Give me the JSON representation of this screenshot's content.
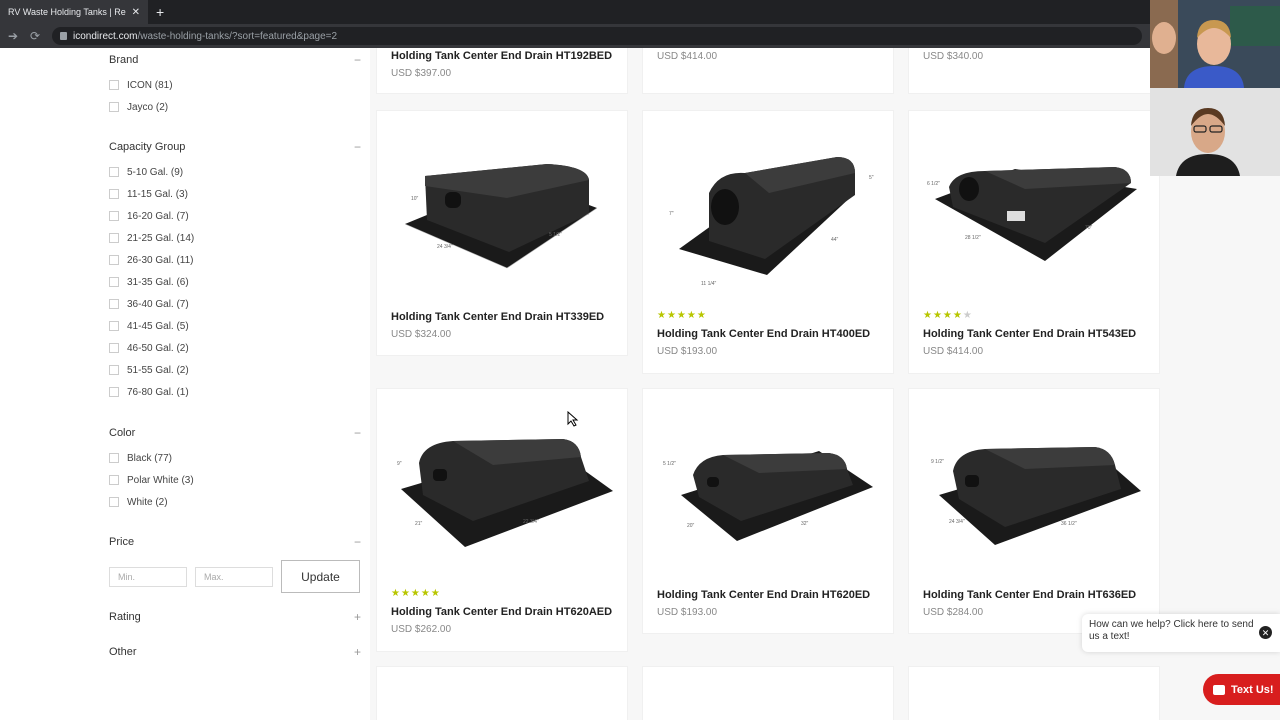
{
  "browser": {
    "tab_title": "RV Waste Holding Tanks | Replac",
    "tab_close": "✕",
    "new_tab": "+",
    "url_host": "icondirect.com",
    "url_path": "/waste-holding-tanks/?sort=featured&page=2"
  },
  "filters": {
    "brand": {
      "title": "Brand",
      "toggle": "−",
      "options": [
        "ICON (81)",
        "Jayco (2)"
      ]
    },
    "capacity": {
      "title": "Capacity Group",
      "toggle": "−",
      "options": [
        "5-10 Gal. (9)",
        "11-15 Gal. (3)",
        "16-20 Gal. (7)",
        "21-25 Gal. (14)",
        "26-30 Gal. (11)",
        "31-35 Gal. (6)",
        "36-40 Gal. (7)",
        "41-45 Gal. (5)",
        "46-50 Gal. (2)",
        "51-55 Gal. (2)",
        "76-80 Gal. (1)"
      ]
    },
    "color": {
      "title": "Color",
      "toggle": "−",
      "options": [
        "Black (77)",
        "Polar White (3)",
        "White (2)"
      ]
    },
    "price": {
      "title": "Price",
      "toggle": "−",
      "min_placeholder": "Min.",
      "max_placeholder": "Max.",
      "update_label": "Update"
    },
    "rating": {
      "title": "Rating",
      "toggle": "+"
    },
    "other": {
      "title": "Other",
      "toggle": "+"
    }
  },
  "products": {
    "top": [
      {
        "name": "Holding Tank Center End Drain HT192BED",
        "price": "USD $397.00"
      },
      {
        "name": "",
        "price": "USD $414.00"
      },
      {
        "name": "",
        "price": "USD $340.00"
      }
    ],
    "row1": [
      {
        "name": "Holding Tank Center End Drain HT339ED",
        "price": "USD $324.00",
        "rating": 0
      },
      {
        "name": "Holding Tank Center End Drain HT400ED",
        "price": "USD $193.00",
        "rating": 5
      },
      {
        "name": "Holding Tank Center End Drain HT543ED",
        "price": "USD $414.00",
        "rating": 4
      }
    ],
    "row2": [
      {
        "name": "Holding Tank Center End Drain HT620AED",
        "price": "USD $262.00",
        "rating": 5
      },
      {
        "name": "Holding Tank Center End Drain HT620ED",
        "price": "USD $193.00",
        "rating": 0
      },
      {
        "name": "Holding Tank Center End Drain HT636ED",
        "price": "USD $284.00",
        "rating": 0
      }
    ]
  },
  "dims": {
    "t1": [
      "10\"",
      "24 3/4\"",
      "5 1/2\""
    ],
    "t2": [
      "7\"",
      "11 1/4\"",
      "44\"",
      "5\""
    ],
    "t3": [
      "6 1/2\"",
      "28 1/2\"",
      "70\""
    ],
    "t4": [
      "9\"",
      "21\"",
      "22 3/4\""
    ],
    "t5": [
      "5 1/2\"",
      "20\"",
      "32\""
    ],
    "t6": [
      "9 1/2\"",
      "24 3/4\"",
      "36 1/2\""
    ]
  },
  "chat": {
    "prompt": "How can we help? Click here to send us a text!",
    "close": "✕",
    "text_button": "Text Us!"
  },
  "colors": {
    "accent_red": "#d81e1e",
    "star": "#b8c600"
  }
}
